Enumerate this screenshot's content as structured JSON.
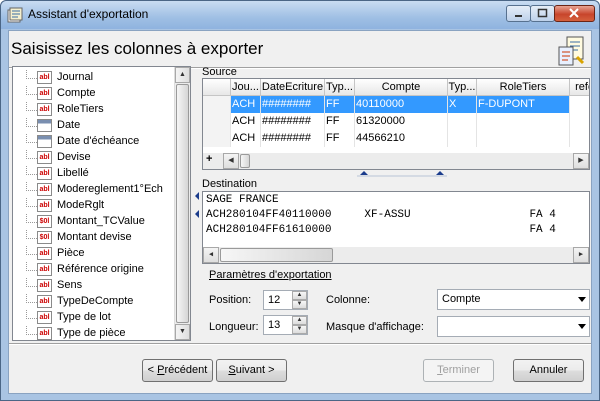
{
  "window": {
    "title": "Assistant d'exportation"
  },
  "heading": "Saisissez les colonnes à exporter",
  "tree": {
    "items": [
      {
        "label": "Journal",
        "icon": "abl-text-field-icon"
      },
      {
        "label": "Compte",
        "icon": "abl-text-field-icon"
      },
      {
        "label": "RoleTiers",
        "icon": "abl-text-field-icon"
      },
      {
        "label": "Date",
        "icon": "date-field-icon"
      },
      {
        "label": "Date d'échéance",
        "icon": "date-field-icon"
      },
      {
        "label": "Devise",
        "icon": "abl-text-field-icon"
      },
      {
        "label": "Libellé",
        "icon": "abl-text-field-icon"
      },
      {
        "label": "Modereglement1°Ech",
        "icon": "abl-text-field-icon"
      },
      {
        "label": "ModeRglt",
        "icon": "abl-text-field-icon"
      },
      {
        "label": "Montant_TCValue",
        "icon": "money-field-icon"
      },
      {
        "label": "Montant devise",
        "icon": "money-field-icon"
      },
      {
        "label": "Pièce",
        "icon": "abl-text-field-icon"
      },
      {
        "label": "Référence origine",
        "icon": "abl-text-field-icon"
      },
      {
        "label": "Sens",
        "icon": "abl-text-field-icon"
      },
      {
        "label": "TypeDeCompte",
        "icon": "abl-text-field-icon"
      },
      {
        "label": "Type de lot",
        "icon": "abl-text-field-icon"
      },
      {
        "label": "Type de pièce",
        "icon": "abl-text-field-icon"
      }
    ],
    "icon_text": {
      "abl": "abl",
      "money": "$0l",
      "date": ""
    }
  },
  "source": {
    "label": "Source",
    "columns": [
      "Jou...",
      "DateEcriture",
      "Typ...",
      "Compte",
      "Typ...",
      "RoleTiers",
      "refere"
    ],
    "rows": [
      [
        "ACH",
        "########",
        "FF",
        "40110000",
        "X",
        "F-DUPONT",
        ""
      ],
      [
        "ACH",
        "########",
        "FF",
        "61320000",
        "",
        "",
        ""
      ],
      [
        "ACH",
        "########",
        "FF",
        "44566210",
        "",
        "",
        ""
      ]
    ],
    "selected_row": 0,
    "plus_label": "+"
  },
  "destination": {
    "label": "Destination",
    "lines": [
      "SAGE FRANCE",
      "ACH280104FF40110000     XF-ASSU                  FA 4",
      "ACH280104FF61610000                              FA 4"
    ]
  },
  "params": {
    "title": "Paramètres d'exportation",
    "position_label": "Position:",
    "position_value": "12",
    "longueur_label": "Longueur:",
    "longueur_value": "13",
    "colonne_label": "Colonne:",
    "colonne_value": "Compte",
    "masque_label": "Masque d'affichage:",
    "masque_value": ""
  },
  "buttons": {
    "precedent_prefix": "< ",
    "precedent_accel": "P",
    "precedent_rest": "récédent",
    "suivant_accel": "S",
    "suivant_rest": "uivant >",
    "terminer_accel": "T",
    "terminer_rest": "erminer",
    "annuler": "Annuler"
  },
  "colors": {
    "selection": "#3399ff",
    "titlebar": "#9fbfe4",
    "close": "#c8452c"
  }
}
